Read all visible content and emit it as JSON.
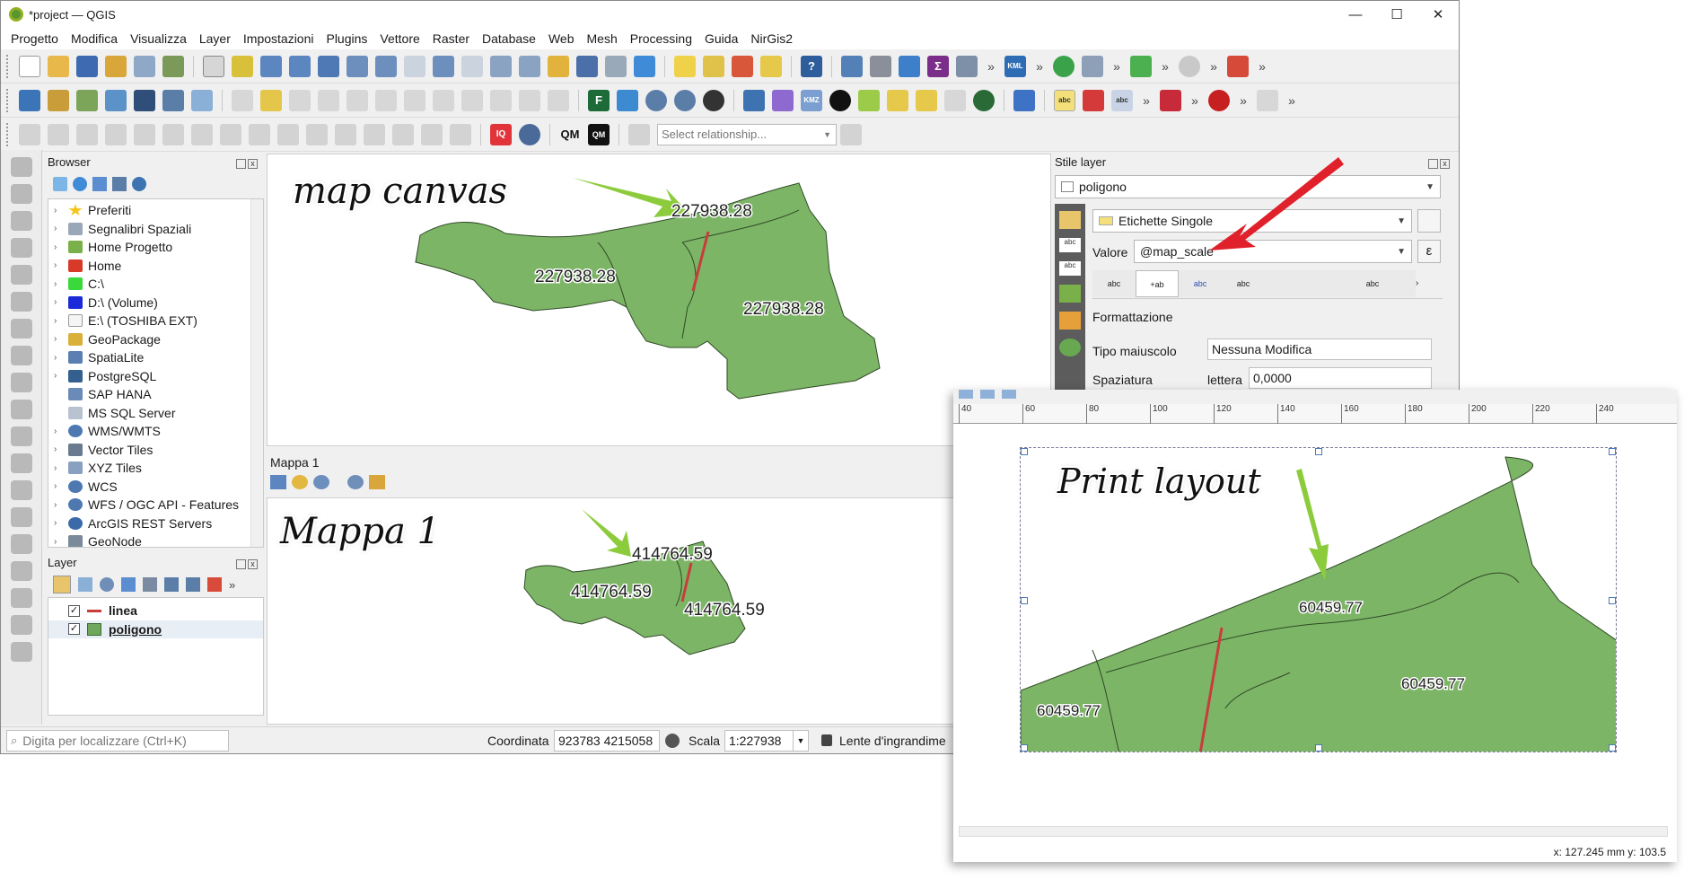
{
  "window": {
    "title": "*project — QGIS",
    "minimize": "—",
    "maximize": "☐",
    "close": "✕"
  },
  "menus": [
    "Progetto",
    "Modifica",
    "Visualizza",
    "Layer",
    "Impostazioni",
    "Plugins",
    "Vettore",
    "Raster",
    "Database",
    "Web",
    "Mesh",
    "Processing",
    "Guida",
    "NirGis2"
  ],
  "toolbar": {
    "overflow": "»",
    "qm_label": "QM",
    "relationship_placeholder": "Select relationship..."
  },
  "browser": {
    "title": "Browser",
    "items": [
      "Preferiti",
      "Segnalibri Spaziali",
      "Home Progetto",
      "Home",
      "C:\\",
      "D:\\ (Volume)",
      "E:\\ (TOSHIBA EXT)",
      "GeoPackage",
      "SpatiaLite",
      "PostgreSQL",
      "SAP HANA",
      "MS SQL Server",
      "WMS/WMTS",
      "Vector Tiles",
      "XYZ Tiles",
      "WCS",
      "WFS / OGC API - Features",
      "ArcGIS REST Servers",
      "GeoNode"
    ]
  },
  "layers": {
    "title": "Layer",
    "items": [
      {
        "name": "linea",
        "checked": "✓",
        "color": "#c83c3c"
      },
      {
        "name": "poligono",
        "checked": "✓",
        "color": "#6fa85c"
      }
    ]
  },
  "map_canvas": {
    "annotation": "map canvas",
    "labels": [
      "227938.28",
      "227938.28",
      "227938.28"
    ],
    "polygon_color": "#7db567"
  },
  "mappa1": {
    "title": "Mappa 1",
    "annotation": "Mappa 1",
    "labels": [
      "414764.59",
      "414764.59",
      "414764.59"
    ]
  },
  "style_panel": {
    "title": "Stile layer",
    "layer_combo": "poligono",
    "mode_combo": "Etichette Singole",
    "valore_label": "Valore",
    "valore_value": "@map_scale",
    "epsilon": "ε",
    "section": "Formattazione",
    "tipo_label": "Tipo maiuscolo",
    "tipo_value": "Nessuna Modifica",
    "spaziatura_label": "Spaziatura",
    "lettera_label": "lettera",
    "lettera_value": "0,0000"
  },
  "statusbar": {
    "search_placeholder": "Digita per localizzare (Ctrl+K)",
    "coord_label": "Coordinata",
    "coord_value": "923783 4215058",
    "scale_label": "Scala",
    "scale_value": "1:227938",
    "magnifier_label": "Lente d'ingrandime"
  },
  "print_layout": {
    "annotation": "Print layout",
    "labels": [
      "60459.77",
      "60459.77",
      "60459.77"
    ],
    "ruler_ticks": [
      "40",
      "60",
      "80",
      "100",
      "120",
      "140",
      "160",
      "180",
      "200",
      "220",
      "240"
    ],
    "cursor_pos": "x: 127.245 mm   y: 103.5"
  },
  "colors": {
    "polygon": "#7db567",
    "line": "#c83c3c",
    "arrow_green": "#8ccc3c",
    "arrow_red": "#e0202a"
  }
}
